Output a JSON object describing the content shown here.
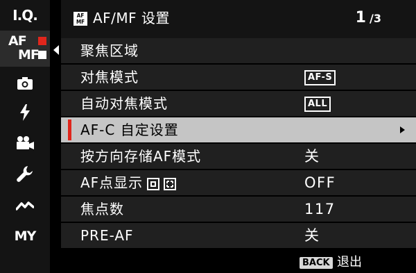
{
  "sidebar": {
    "items": [
      {
        "id": "iq",
        "label": "I.Q."
      },
      {
        "id": "afmf",
        "label_top": "AF",
        "label_bottom": "MF"
      },
      {
        "id": "camera",
        "icon": "camera-icon"
      },
      {
        "id": "flash",
        "icon": "flash-icon"
      },
      {
        "id": "movie",
        "icon": "movie-camera-icon"
      },
      {
        "id": "setup",
        "icon": "wrench-icon"
      },
      {
        "id": "connection",
        "icon": "connection-icon"
      },
      {
        "id": "my",
        "label": "MY"
      }
    ],
    "active": "afmf"
  },
  "header": {
    "icon_text_top": "AF",
    "icon_text_bottom": "MF",
    "title": "AF/MF 设置",
    "page_current": "1",
    "page_total": "/3"
  },
  "menu": {
    "rows": [
      {
        "label": "聚焦区域",
        "value": ""
      },
      {
        "label": "对焦模式",
        "value": "AF-S"
      },
      {
        "label": "自动对焦模式",
        "value": "ALL"
      },
      {
        "label": "AF-C 自定设置",
        "value": ""
      },
      {
        "label": "按方向存储AF模式",
        "value": "关"
      },
      {
        "label": "AF点显示",
        "value": "OFF"
      },
      {
        "label": "焦点数",
        "value": "117"
      },
      {
        "label": "PRE-AF",
        "value": "关"
      }
    ],
    "selected_index": 3
  },
  "footer": {
    "back_key": "BACK",
    "back_label": "退出"
  },
  "colors": {
    "accent_red": "#e0261c",
    "selected_row_bg": "#c5c5c5",
    "row_bg": "#202020",
    "sidebar_bg": "#141414"
  }
}
